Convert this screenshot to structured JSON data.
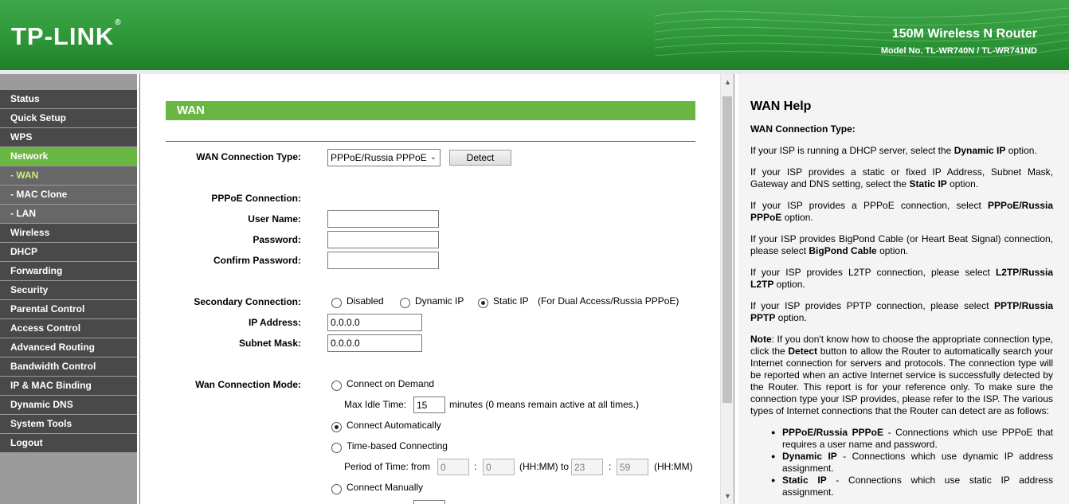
{
  "header": {
    "logo": "TP-LINK",
    "logo_mark": "®",
    "product_title": "150M Wireless N Router",
    "model": "Model No. TL-WR740N / TL-WR741ND"
  },
  "sidebar": {
    "items": [
      {
        "label": "Status"
      },
      {
        "label": "Quick Setup"
      },
      {
        "label": "WPS"
      },
      {
        "label": "Network"
      },
      {
        "label": "- WAN"
      },
      {
        "label": "- MAC Clone"
      },
      {
        "label": "- LAN"
      },
      {
        "label": "Wireless"
      },
      {
        "label": "DHCP"
      },
      {
        "label": "Forwarding"
      },
      {
        "label": "Security"
      },
      {
        "label": "Parental Control"
      },
      {
        "label": "Access Control"
      },
      {
        "label": "Advanced Routing"
      },
      {
        "label": "Bandwidth Control"
      },
      {
        "label": "IP & MAC Binding"
      },
      {
        "label": "Dynamic DNS"
      },
      {
        "label": "System Tools"
      },
      {
        "label": "Logout"
      }
    ]
  },
  "main": {
    "section_title": "WAN",
    "wan_type_label": "WAN Connection Type:",
    "wan_type_value": "PPPoE/Russia PPPoE",
    "detect_button": "Detect",
    "pppoe_heading": "PPPoE Connection:",
    "username_label": "User Name:",
    "username_value": "",
    "password_label": "Password:",
    "password_value": "",
    "confirm_label": "Confirm Password:",
    "confirm_value": "",
    "secondary_label": "Secondary Connection:",
    "secondary_options": [
      "Disabled",
      "Dynamic IP",
      "Static IP"
    ],
    "secondary_selected": "Static IP",
    "secondary_note": "(For Dual Access/Russia PPPoE)",
    "ip_label": "IP Address:",
    "ip_value": "0.0.0.0",
    "mask_label": "Subnet Mask:",
    "mask_value": "0.0.0.0",
    "mode_label": "Wan Connection Mode:",
    "mode_on_demand": "Connect on Demand",
    "max_idle_label": "Max Idle Time:",
    "max_idle_value": "15",
    "max_idle_note": "minutes (0 means remain active at all times.)",
    "mode_auto": "Connect Automatically",
    "mode_time": "Time-based Connecting",
    "period_label": "Period of Time: from",
    "from_h": "0",
    "from_m": "0",
    "hhmm_to": "(HH:MM) to",
    "to_h": "23",
    "to_m": "59",
    "hhmm": "(HH:MM)",
    "colon": ":",
    "mode_manual": "Connect Manually",
    "mode_selected": "Connect Automatically"
  },
  "help": {
    "title": "WAN Help",
    "subtitle": "WAN Connection Type:",
    "p1_pre": "If your ISP is running a DHCP server, select the ",
    "p1_b": "Dynamic IP",
    "p1_post": " option.",
    "p2_pre": "If your ISP provides a static or fixed IP Address, Subnet Mask, Gateway and DNS setting, select the ",
    "p2_b": "Static IP",
    "p2_post": " option.",
    "p3_pre": "If your ISP provides a PPPoE connection, select ",
    "p3_b": "PPPoE/Russia PPPoE",
    "p3_post": " option.",
    "p4_pre": "If your ISP provides BigPond Cable (or Heart Beat Signal) connection, please select ",
    "p4_b": "BigPond Cable",
    "p4_post": " option.",
    "p5_pre": "If your ISP provides L2TP connection, please select ",
    "p5_b": "L2TP/Russia L2TP",
    "p5_post": " option.",
    "p6_pre": "If your ISP provides PPTP connection, please select ",
    "p6_b": "PPTP/Russia PPTP",
    "p6_post": " option.",
    "note_b": "Note",
    "note_1": ": If you don't know how to choose the appropriate connection type, click the ",
    "note_detect": "Detect",
    "note_2": " button to allow the Router to automatically search your Internet connection for servers and protocols. The connection type will be reported when an active Internet service is successfully detected by the Router. This report is for your reference only. To make sure the connection type your ISP provides, please refer to the ISP. The various types of Internet connections that the Router can detect are as follows:",
    "bullets": [
      {
        "b": "PPPoE/Russia PPPoE",
        "t": " - Connections which use PPPoE that requires a user name and password."
      },
      {
        "b": "Dynamic IP",
        "t": " - Connections which use dynamic IP address assignment."
      },
      {
        "b": "Static IP",
        "t": " - Connections which use static IP address assignment."
      }
    ]
  },
  "colors": {
    "brand_green": "#6ab643",
    "header_green": "#2d9738",
    "nav_dark": "#494949",
    "nav_sub": "#676767",
    "help_bg": "#f4f4f4"
  },
  "icons": {
    "scroll_up": "chevron-up-icon",
    "scroll_down": "chevron-down-icon",
    "select_arrow": "chevron-down-icon"
  }
}
